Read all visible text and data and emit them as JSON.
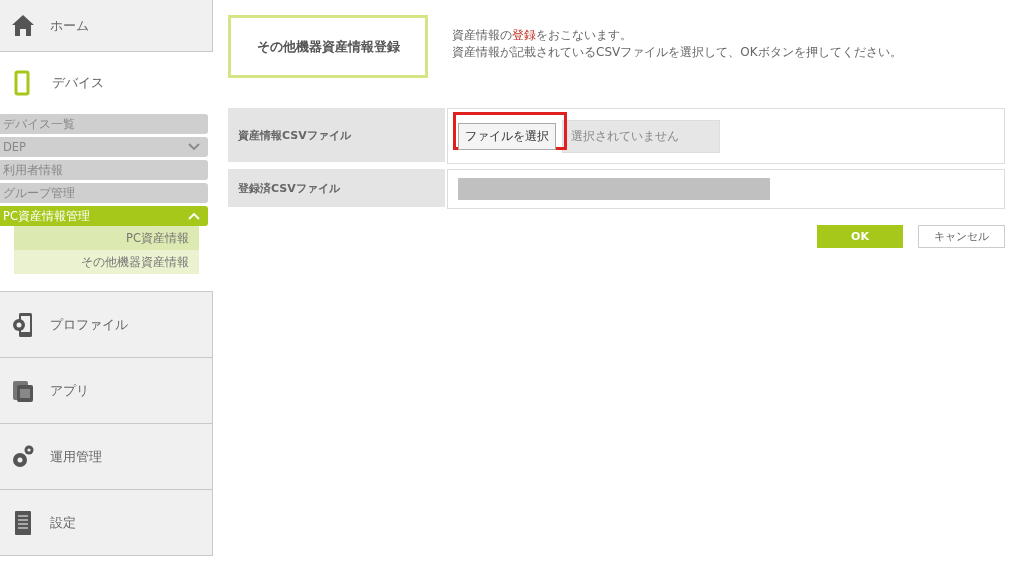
{
  "sidebar": {
    "items": [
      {
        "kind": "main",
        "label": "ホーム",
        "selected": false
      },
      {
        "kind": "section",
        "label": "デバイス",
        "selected": true,
        "children": [
          {
            "label": "デバイス一覧",
            "selected": false
          },
          {
            "label": "DEP",
            "selected": false,
            "expanded": false
          },
          {
            "label": "利用者情報",
            "selected": false
          },
          {
            "label": "グループ管理",
            "selected": false
          },
          {
            "label": "PC資産情報管理",
            "selected": true,
            "expanded": true,
            "children": [
              {
                "label": "PC資産情報",
                "selected": false
              },
              {
                "label": "その他機器資産情報",
                "selected": true
              }
            ]
          }
        ]
      },
      {
        "kind": "main",
        "label": "プロファイル",
        "selected": false
      },
      {
        "kind": "main",
        "label": "アプリ",
        "selected": false
      },
      {
        "kind": "main",
        "label": "運用管理",
        "selected": false
      },
      {
        "kind": "main",
        "label": "設定",
        "selected": false
      }
    ]
  },
  "page": {
    "title": "その他機器資産情報登録",
    "description": [
      "資産情報の**登録**をおこないます。",
      "資産情報が記載されているCSVファイルを選択して、OKボタンを押してください。"
    ]
  },
  "form": {
    "rows": [
      {
        "kind": "file",
        "label": "資産情報CSVファイル",
        "button": "ファイルを選択",
        "placeholder": "選択されていません",
        "highlighted": true
      },
      {
        "kind": "redacted",
        "label": "登録済CSVファイル"
      }
    ]
  },
  "buttons": [
    {
      "kind": "primary",
      "label": "OK"
    },
    {
      "kind": "secondary",
      "label": "キャンセル"
    }
  ]
}
